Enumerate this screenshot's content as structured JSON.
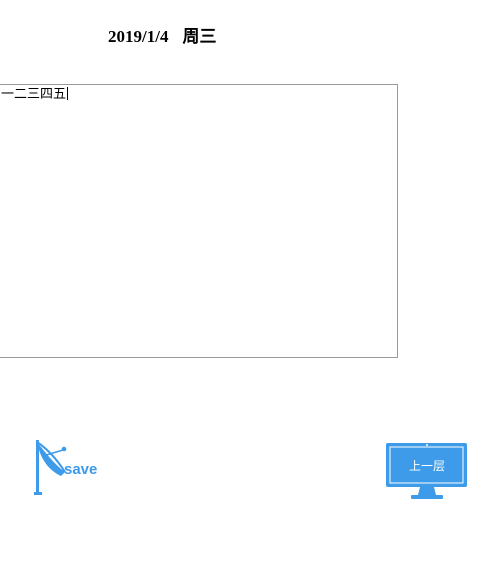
{
  "header": {
    "date": "2019/1/4",
    "weekday": "周三"
  },
  "editor": {
    "text": "一二三四五"
  },
  "buttons": {
    "save_label": "save",
    "up_label": "上一层",
    "accent_color": "#3d9be9"
  },
  "icons": {
    "save": "satellite-dish-icon",
    "up": "monitor-icon"
  }
}
